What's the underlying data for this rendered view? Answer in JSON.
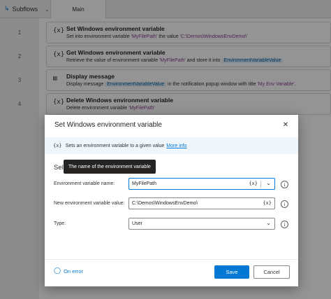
{
  "topbar": {
    "subflows_label": "Subflows",
    "subflows_icon": "flow-icon",
    "main_tab": "Main"
  },
  "steps": [
    {
      "num": "1",
      "icon": "{x}",
      "title": "Set Windows environment variable",
      "desc_pre": "Set into environment variable ",
      "desc_var": "'MyFilePath'",
      "desc_mid": " the value ",
      "desc_val": "'C:\\Demos\\WindowsEnvDemo\\'"
    },
    {
      "num": "2",
      "icon": "{x}",
      "title": "Get Windows environment variable",
      "desc_pre": "Retrieve the value of environment variable ",
      "desc_var": "'MyFilePath'",
      "desc_mid": " and store it into ",
      "desc_pill": "EnvironmentVariableValue"
    },
    {
      "num": "3",
      "icon": "message-icon",
      "title": "Display message",
      "desc_pre": "Display message ",
      "desc_pill": "EnvironmentVariableValue",
      "desc_mid": " in the notification popup window with title ",
      "desc_var": "'My Env Variable'",
      "desc_end": "."
    },
    {
      "num": "4",
      "icon": "{x}",
      "title": "Delete Windows environment variable",
      "desc_pre": "Delete environment variable ",
      "desc_var": "'MyFilePath'"
    }
  ],
  "dialog": {
    "title": "Set Windows environment variable",
    "info_icon": "{x}",
    "info_text": "Sets an environment variable to a given value",
    "more_info": "More info",
    "params_label": "Sele",
    "tooltip": "The name of the environment variable",
    "fields": {
      "name_label": "Environment variable name:",
      "name_value": "MyFilePath",
      "value_label": "New environment variable value:",
      "value_value": "C:\\Demos\\WindowsEnvDemo\\",
      "type_label": "Type:",
      "type_value": "User"
    },
    "fx_symbol": "{x}",
    "info_symbol": "i",
    "on_error": "On error",
    "save": "Save",
    "cancel": "Cancel"
  },
  "colors": {
    "accent": "#0078d4",
    "variable": "#8a3d91",
    "pill_bg": "#e1f1fb"
  }
}
